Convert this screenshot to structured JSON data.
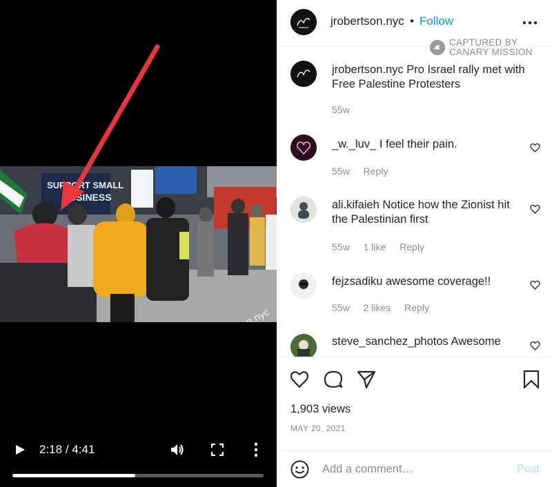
{
  "video": {
    "time_current": "2:18",
    "time_total": "4:41",
    "time_separator": "/",
    "progress_fraction": 0.49,
    "watermark": "@jrobertson.nyc",
    "scene_signage": [
      "SUPPORT SMALL",
      "BUSINESS"
    ]
  },
  "header": {
    "username": "jrobertson.nyc",
    "separator": "•",
    "follow_label": "Follow"
  },
  "canary": {
    "line1": "CAPTURED BY",
    "line2": "CANARY MISSION"
  },
  "caption": {
    "username": "jrobertson.nyc",
    "text": "Pro Israel rally met with Free Palestine Protesters",
    "age": "55w"
  },
  "comments": [
    {
      "username": "_w._luv_",
      "text": "I feel their pain.",
      "age": "55w",
      "likes": "",
      "reply": "Reply"
    },
    {
      "username": "ali.kifaieh",
      "text": "Notice how the Zionist hit the Palestinian first",
      "age": "55w",
      "likes": "1 like",
      "reply": "Reply"
    },
    {
      "username": "fejzsadiku",
      "text": "awesome coverage!!",
      "age": "55w",
      "likes": "2 likes",
      "reply": "Reply"
    },
    {
      "username": "steve_sanchez_photos",
      "text": "Awesome",
      "age": "",
      "likes": "",
      "reply": ""
    }
  ],
  "stats": {
    "views": "1,903 views",
    "date": "MAY 20, 2021"
  },
  "composer": {
    "placeholder": "Add a comment…",
    "post_label": "Post"
  },
  "colors": {
    "link_blue": "#0095f6",
    "post_disabled": "#b2dffc",
    "arrow_red": "#e8373c",
    "muted": "#8e8e8e"
  }
}
